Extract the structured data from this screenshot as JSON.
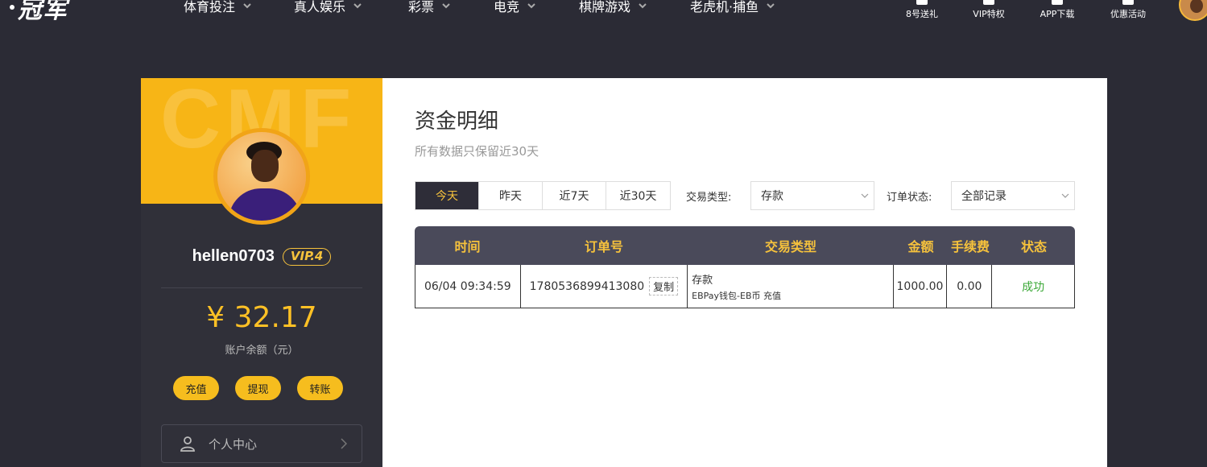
{
  "topbar": {
    "logo": "冠军",
    "nav": [
      {
        "label": "体育投注"
      },
      {
        "label": "真人娱乐"
      },
      {
        "label": "彩票"
      },
      {
        "label": "电竞"
      },
      {
        "label": "棋牌游戏"
      },
      {
        "label": "老虎机·捕鱼"
      }
    ],
    "quick": [
      {
        "label": "8号送礼",
        "icon": "gift-icon"
      },
      {
        "label": "VIP特权",
        "icon": "vip-icon"
      },
      {
        "label": "APP下载",
        "icon": "phone-icon"
      },
      {
        "label": "优惠活动",
        "icon": "promo-icon"
      }
    ]
  },
  "sidebar": {
    "watermark": "CMF",
    "username": "hellen0703",
    "vip": "VIP.4",
    "balance": "¥ 32.17",
    "balance_label": "账户余额（元）",
    "actions": [
      "充值",
      "提现",
      "转账"
    ],
    "menu": {
      "label": "个人中心"
    }
  },
  "main": {
    "title": "资金明细",
    "subtitle": "所有数据只保留近30天",
    "tabs": [
      "今天",
      "昨天",
      "近7天",
      "近30天"
    ],
    "filter_type_label": "交易类型:",
    "filter_type_value": "存款",
    "filter_status_label": "订单状态:",
    "filter_status_value": "全部记录",
    "table": {
      "headers": [
        "时间",
        "订单号",
        "交易类型",
        "金额",
        "手续费",
        "状态"
      ],
      "copy_label": "复制",
      "rows": [
        {
          "time": "06/04 09:34:59",
          "order": "1780536899413080",
          "type": "存款",
          "type_detail": "EBPay钱包-EB币 充值",
          "amount": "1000.00",
          "fee": "0.00",
          "status": "成功"
        }
      ]
    }
  },
  "colors": {
    "accent": "#f6c23c",
    "success": "#3aa836",
    "dark": "#2b2b35"
  }
}
